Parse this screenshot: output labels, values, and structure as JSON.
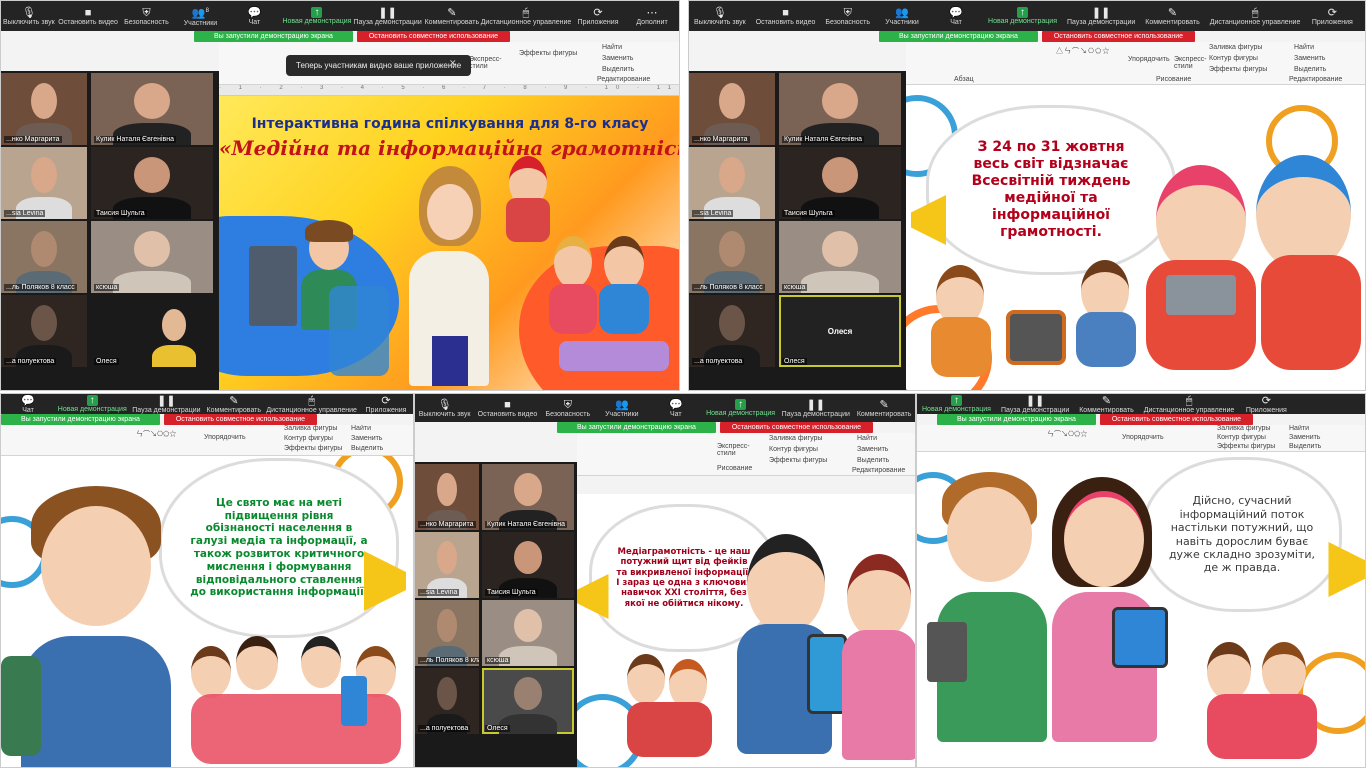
{
  "toolbar": {
    "items": [
      "Выключить звук",
      "Остановить видео",
      "Безопасность",
      "Участники",
      "Чат",
      "Новая демонстрация",
      "Пауза демонстрации",
      "Комментировать",
      "Дистанционное управление",
      "Приложения",
      "Дополнит"
    ],
    "participants_count": "8"
  },
  "notice": {
    "share": "Вы запустили демонстрацию экрана",
    "stop": "Остановить совместное использование"
  },
  "tooltip": {
    "text": "Теперь участникам видно ваше приложение"
  },
  "ribbon": {
    "find": "Найти",
    "replace": "Заменить",
    "select": "Выделить",
    "fill": "Заливка фигуры",
    "outline": "Контур фигуры",
    "effects": "Эффекты фигуры",
    "arrange": "Упорядочить",
    "styles": "Экспресс-стили",
    "editing": "Редактирование",
    "drawing": "Рисование",
    "paragraph": "Абзац"
  },
  "ruler": "· 1 · 2 · 3 · 4 · 5 · 6 · 7 · 8 · 9 · 10 · 11 · 12",
  "participants": [
    "...нко Маргарита",
    "Кулик Наталя Євгенівна",
    "...sia Levina",
    "Таисия Шульга",
    "...ль Поляков 8 класс",
    "ксюша",
    "...а полуектова",
    "Олеся"
  ],
  "slides": {
    "s1_line1": "Інтерактивна година спілкування для 8-го класу",
    "s1_line2": "«Медійна та інформаційна грамотність»",
    "s2": "З 24 по 31 жовтня весь світ відзначає Всесвітній тиждень медійної та інформаційної грамотності.",
    "s3": "Це свято має на меті підвищення рівня обізнаності населення в галузі медіа та інформації, а також розвиток критичного мислення і формування відповідального ставлення до використання інформації.",
    "s4": "Медіаграмотність - це наш потужний щит від фейків та викривленої інформації. І зараз це одна з ключових навичок XXI століття, без якої не обійтися нікому.",
    "s5": "Дійсно, сучасний інформаційний поток настільки потужний, що навіть дорослим буває дуже складно зрозуміти, де ж правда."
  },
  "colors": {
    "zoom_bar": "#242424",
    "share_green": "#2db24a",
    "stop_red": "#d6202a",
    "title_navy": "#1b2f8e",
    "title_red": "#c4121b",
    "s2_text": "#b3001b",
    "s3_text": "#0a8a2e",
    "s4_text": "#a0001a",
    "s5_text": "#3a3a3a",
    "megaphone": "#f5c518"
  }
}
